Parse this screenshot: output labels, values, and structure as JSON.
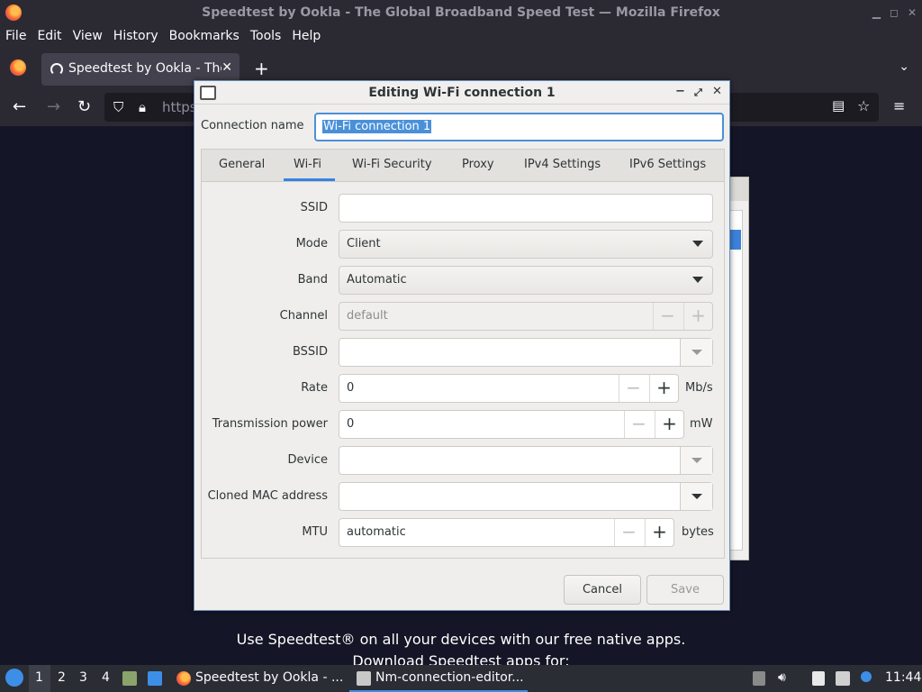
{
  "window": {
    "title": "Speedtest by Ookla - The Global Broadband Speed Test — Mozilla Firefox"
  },
  "menu": [
    "File",
    "Edit",
    "View",
    "History",
    "Bookmarks",
    "Tools",
    "Help"
  ],
  "browser": {
    "tab_label": "Speedtest by Ookla - The Global Broadband Speed Test",
    "url_text": "https",
    "page_text_1": "Use Speedtest® on all your devices with our free native apps.",
    "page_text_2": "Download Speedtest apps for:"
  },
  "dialog": {
    "title": "Editing Wi-Fi connection 1",
    "connection_name_label": "Connection name",
    "connection_name_value": "Wi-Fi connection 1",
    "tabs": [
      "General",
      "Wi-Fi",
      "Wi-Fi Security",
      "Proxy",
      "IPv4 Settings",
      "IPv6 Settings"
    ],
    "active_tab": "Wi-Fi",
    "fields": {
      "ssid_label": "SSID",
      "ssid_value": "",
      "mode_label": "Mode",
      "mode_value": "Client",
      "band_label": "Band",
      "band_value": "Automatic",
      "channel_label": "Channel",
      "channel_value": "default",
      "bssid_label": "BSSID",
      "bssid_value": "",
      "rate_label": "Rate",
      "rate_value": "0",
      "rate_unit": "Mb/s",
      "txpower_label": "Transmission power",
      "txpower_value": "0",
      "txpower_unit": "mW",
      "device_label": "Device",
      "device_value": "",
      "mac_label": "Cloned MAC address",
      "mac_value": "",
      "mtu_label": "MTU",
      "mtu_value": "automatic",
      "mtu_unit": "bytes"
    },
    "cancel_label": "Cancel",
    "save_label": "Save"
  },
  "taskbar": {
    "workspaces": [
      "1",
      "2",
      "3",
      "4"
    ],
    "app1": "Speedtest by Ookla - ...",
    "app2": "Nm-connection-editor...",
    "clock": "11:44"
  },
  "colors": {
    "accent": "#3584e4",
    "selection": "#4a90d9",
    "page_bg": "#141526"
  }
}
